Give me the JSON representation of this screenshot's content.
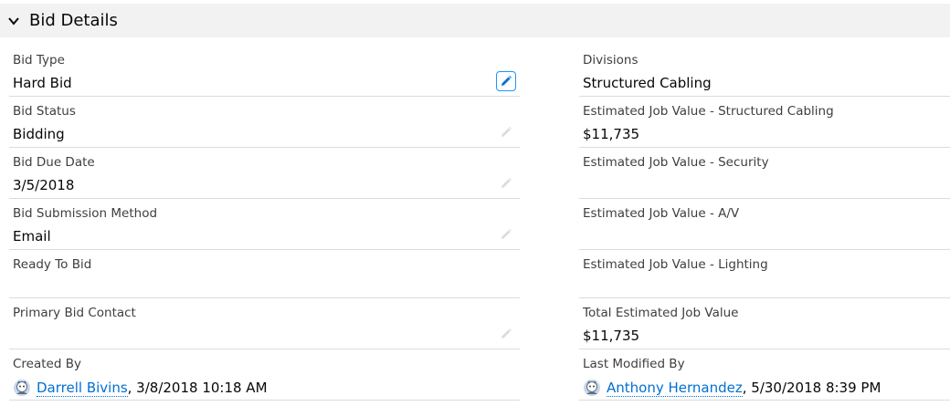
{
  "section": {
    "title": "Bid Details"
  },
  "left_fields": [
    {
      "label": "Bid Type",
      "value": "Hard Bid"
    },
    {
      "label": "Bid Status",
      "value": "Bidding"
    },
    {
      "label": "Bid Due Date",
      "value": "3/5/2018"
    },
    {
      "label": "Bid Submission Method",
      "value": "Email"
    },
    {
      "label": "Ready To Bid",
      "value": ""
    },
    {
      "label": "Primary Bid Contact",
      "value": ""
    },
    {
      "label": "Created By",
      "user": "Darrell Bivins",
      "suffix": ", 3/8/2018 10:18 AM"
    }
  ],
  "right_fields": [
    {
      "label": "Divisions",
      "value": "Structured Cabling"
    },
    {
      "label": "Estimated Job Value - Structured Cabling",
      "value": "$11,735"
    },
    {
      "label": "Estimated Job Value - Security",
      "value": ""
    },
    {
      "label": "Estimated Job Value - A/V",
      "value": ""
    },
    {
      "label": "Estimated Job Value - Lighting",
      "value": ""
    },
    {
      "label": "Total Estimated Job Value",
      "value": "$11,735"
    },
    {
      "label": "Last Modified By",
      "user": "Anthony Hernandez",
      "suffix": ", 5/30/2018 8:39 PM"
    }
  ],
  "colors": {
    "link": "#0070d2",
    "header_bg": "#f3f2f2",
    "edit_active": "#1b96ff"
  },
  "icons": {
    "chevron": "chevron-down-icon",
    "edit": "pencil-icon",
    "avatar": "user-avatar-icon"
  }
}
